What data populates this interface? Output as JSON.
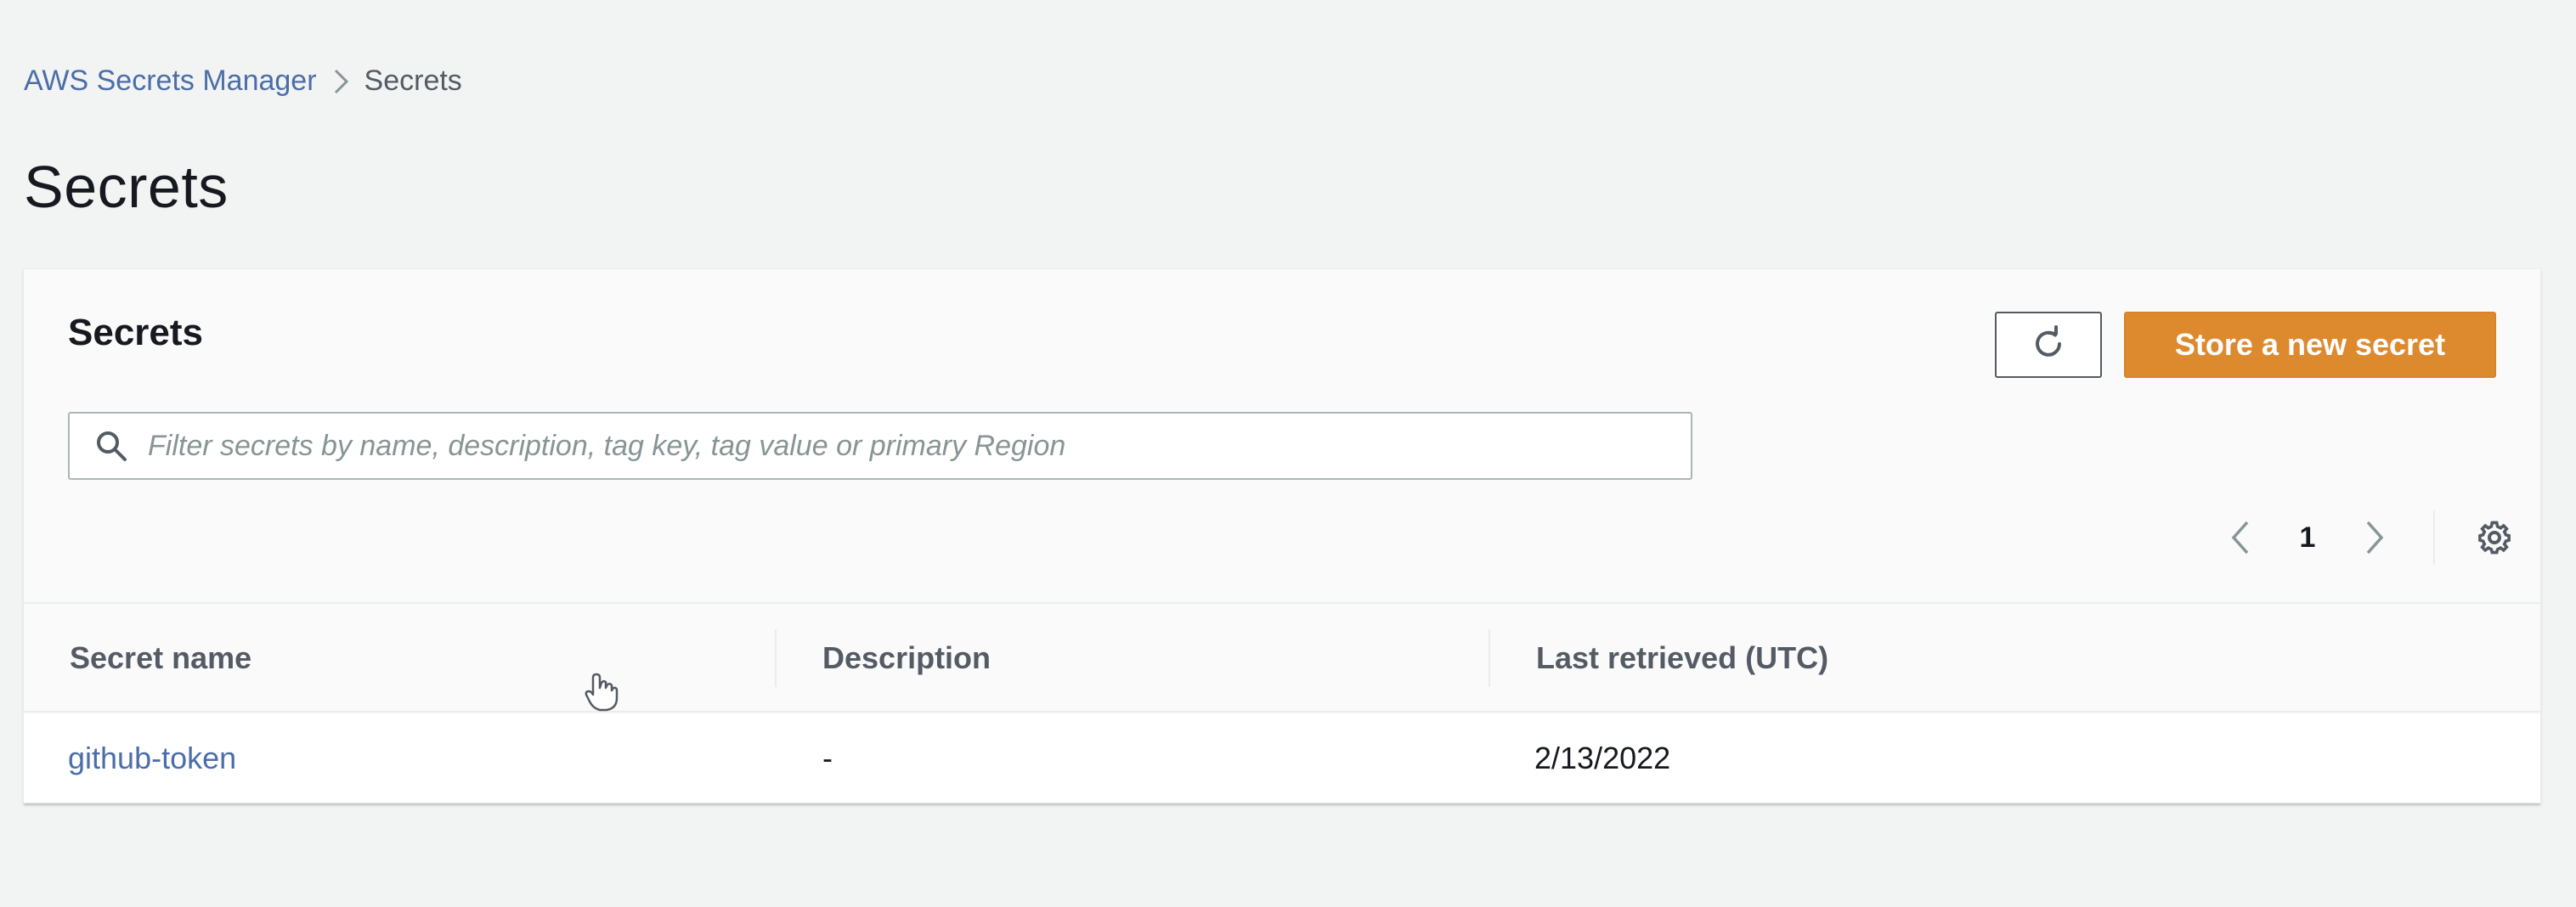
{
  "breadcrumb": {
    "root": "AWS Secrets Manager",
    "current": "Secrets"
  },
  "page_title": "Secrets",
  "panel": {
    "title": "Secrets",
    "primary_button": "Store a new secret",
    "search_placeholder": "Filter secrets by name, description, tag key, tag value or primary Region",
    "current_page": "1"
  },
  "table": {
    "columns": [
      "Secret name",
      "Description",
      "Last retrieved (UTC)"
    ],
    "rows": [
      {
        "name": "github-token",
        "description": "-",
        "last_retrieved": "2/13/2022"
      }
    ]
  },
  "icons": {
    "refresh": "refresh-icon",
    "search": "search-icon",
    "prev": "chevron-left-icon",
    "next": "chevron-right-icon",
    "settings": "gear-icon",
    "breadcrumb_sep": "chevron-right-icon"
  },
  "colors": {
    "primary_button": "#dd8a2f",
    "link": "#4b6ea8",
    "background": "#f2f3f3"
  }
}
